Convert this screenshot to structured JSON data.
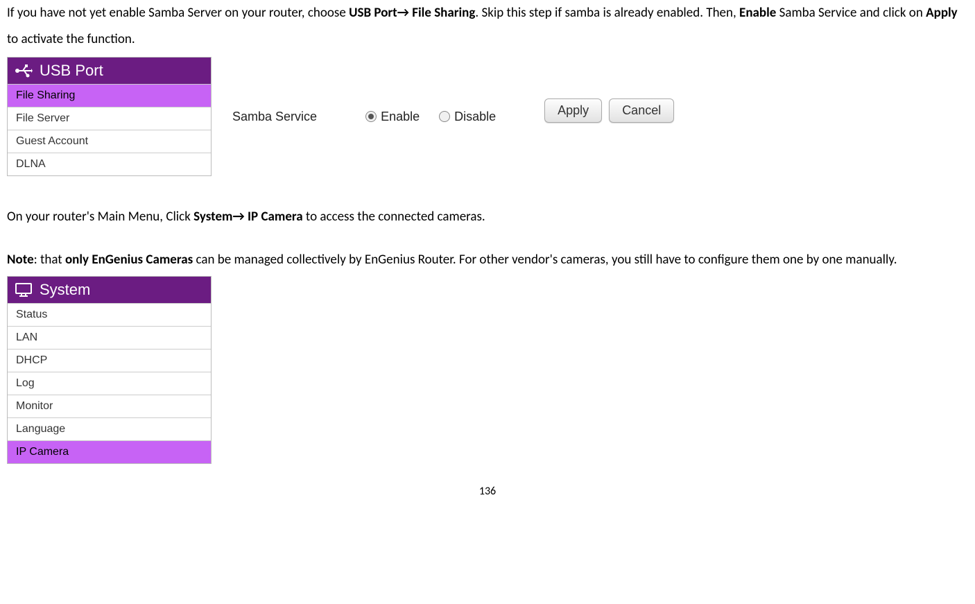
{
  "paragraph1": {
    "t1": "If you have not yet enable Samba Server on your router, choose ",
    "usb_port": "USB Port",
    "arrow1": "→",
    "file_sharing": " File Sharing",
    "t2": ". Skip this step if samba is already enabled. Then, ",
    "enable": "Enable",
    "t3": " Samba Service and click on ",
    "apply": "Apply",
    "t4": " to activate the function."
  },
  "usb_menu": {
    "header": "USB Port",
    "items": [
      "File Sharing",
      "File Server",
      "Guest Account",
      "DLNA"
    ],
    "active_index": 0
  },
  "samba": {
    "label": "Samba Service",
    "enable": "Enable",
    "disable": "Disable",
    "selected": "enable"
  },
  "buttons": {
    "apply": "Apply",
    "cancel": "Cancel"
  },
  "paragraph2": {
    "t1": "On your router's Main Menu, Click ",
    "system": "System",
    "arrow": "→",
    "ip_camera": " IP Camera",
    "t2": " to access the connected cameras."
  },
  "paragraph3": {
    "note": "Note",
    "t1": ": that ",
    "only": "only EnGenius Cameras",
    "t2": " can be managed collectively by EnGenius Router. For other vendor's cameras, you still have to configure them one by one manually."
  },
  "system_menu": {
    "header": "System",
    "items": [
      "Status",
      "LAN",
      "DHCP",
      "Log",
      "Monitor",
      "Language",
      "IP Camera"
    ],
    "active_index": 6
  },
  "page_number": "136"
}
